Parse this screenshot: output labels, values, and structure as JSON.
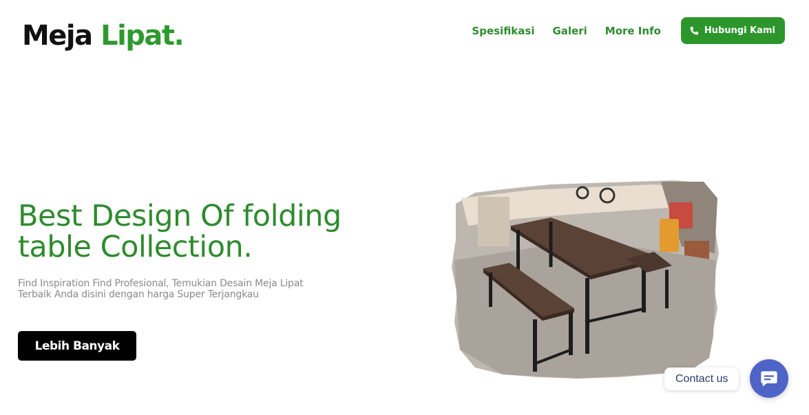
{
  "header": {
    "logo_primary": "Meja",
    "logo_accent": "Lipat.",
    "nav": [
      {
        "label": "Spesifikasi"
      },
      {
        "label": "Galeri"
      },
      {
        "label": "More Info"
      }
    ],
    "cta_label": "Hubungi Kami",
    "cta_icon": "phone-icon"
  },
  "hero": {
    "title_line1": "Best Design Of folding",
    "title_line2": "table Collection.",
    "subtitle_line1": "Find Inspiration Find Profesional, Temukian Desain Meja Lipat",
    "subtitle_line2": "Terbaik Anda disini dengan harga Super Terjangkau",
    "button_label": "Lebih Banyak",
    "image": "folding-table-with-benches-photo"
  },
  "chat_widget": {
    "label": "Contact us",
    "icon": "chat-bubble-icon"
  },
  "colors": {
    "brand_green": "#2e8b2e",
    "cta_green": "#2c962c",
    "chat_blue": "#4f64c7",
    "button_black": "#000000"
  }
}
